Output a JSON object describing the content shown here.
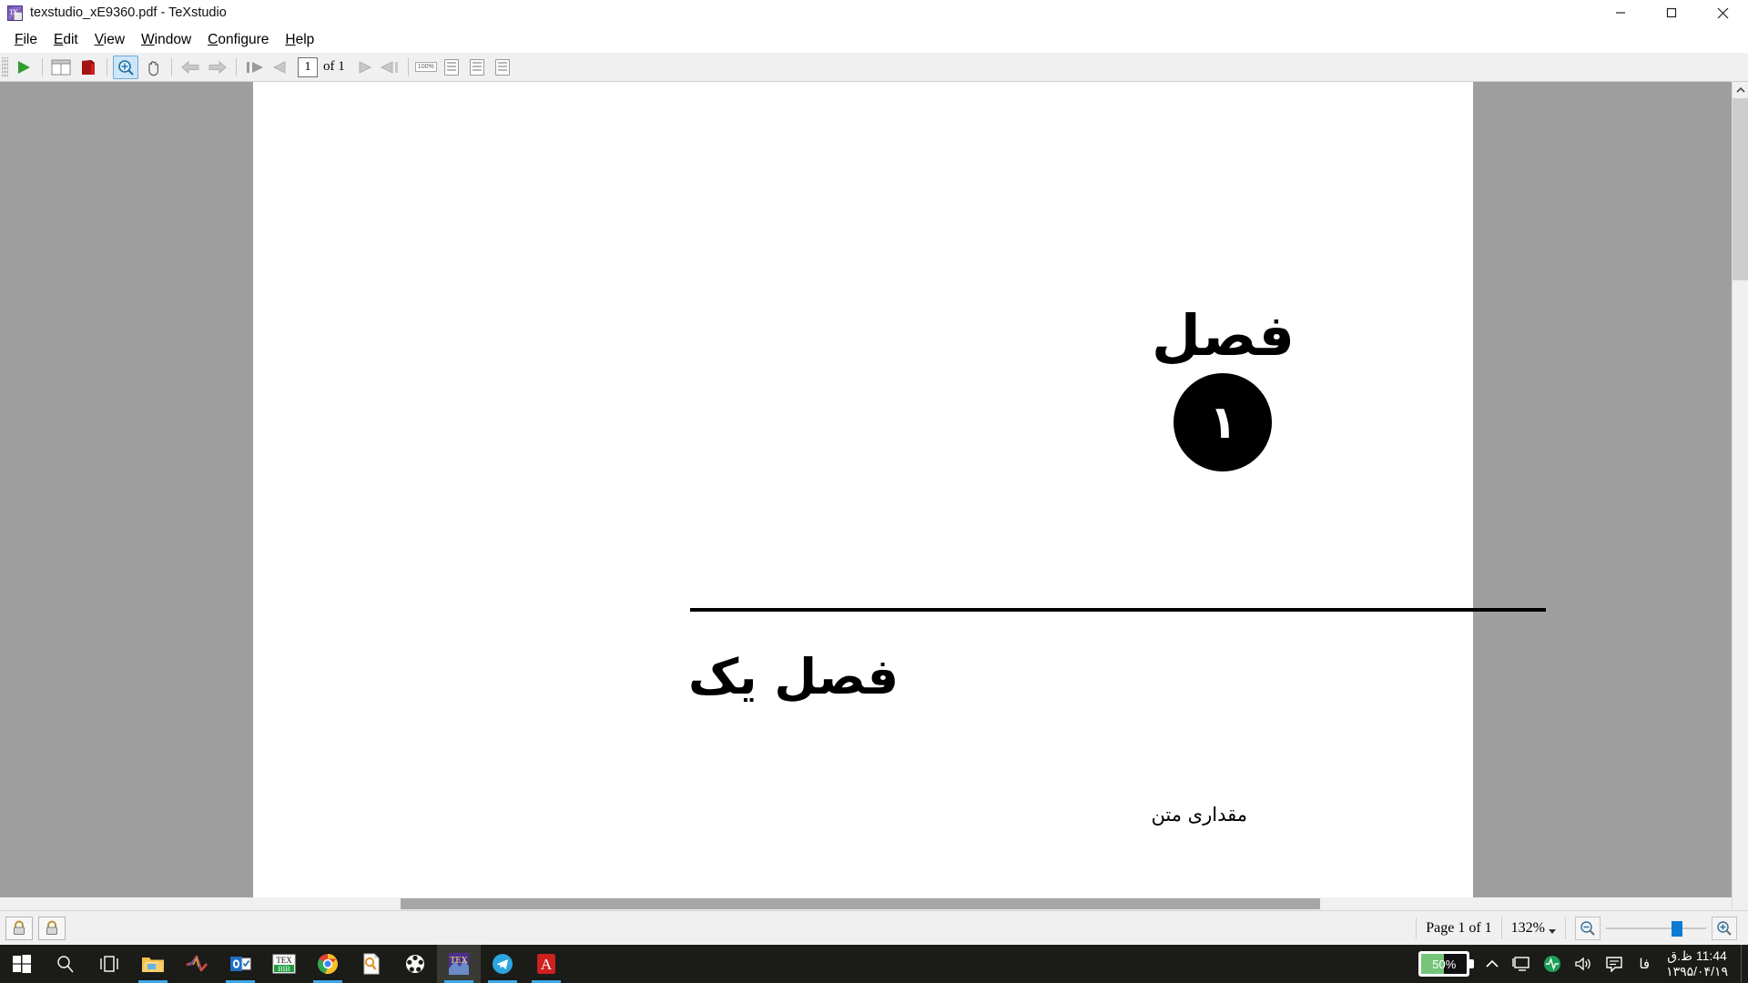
{
  "window": {
    "title": "texstudio_xE9360.pdf - TeXstudio",
    "app_icon": "texstudio-icon",
    "minimize_label": "Minimize",
    "maximize_label": "Maximize",
    "close_label": "Close"
  },
  "menubar": {
    "items": [
      {
        "label": "File",
        "mnemonic": "F",
        "rest": "ile"
      },
      {
        "label": "Edit",
        "mnemonic": "E",
        "rest": "dit"
      },
      {
        "label": "View",
        "mnemonic": "V",
        "rest": "iew"
      },
      {
        "label": "Window",
        "mnemonic": "W",
        "rest": "indow"
      },
      {
        "label": "Configure",
        "mnemonic": "C",
        "rest": "onfigure"
      },
      {
        "label": "Help",
        "mnemonic": "H",
        "rest": "elp"
      }
    ]
  },
  "toolbar": {
    "build_run_label": "Build & View",
    "view_layout_label": "Page Layout",
    "pdf_label": "Open PDF",
    "magnify_label": "Magnify",
    "hand_label": "Scroll Hand Tool",
    "back_label": "Back",
    "forward_label": "Forward",
    "first_page_label": "First Page",
    "prev_page_label": "Previous Page",
    "next_page_label": "Next Page",
    "last_page_label": "Last Page",
    "page_number_value": "1",
    "page_total_text": "of 1",
    "fit_actual_label": "100%",
    "fit_width_label": "Fit to Width",
    "fit_page_label": "Fit to Page",
    "fit_text_label": "Fit to Text Width"
  },
  "document": {
    "chapter_word": "فصل",
    "chapter_number": "۱",
    "chapter_title": "فصل یک",
    "body_text": "مقداری متن"
  },
  "statusbar": {
    "lock_left_label": "Lock Document",
    "lock_right_label": "Lock View",
    "page_text": "Page 1 of 1",
    "zoom_value": "132%",
    "zoom_out_label": "Zoom Out",
    "zoom_in_label": "Zoom In",
    "zoom_slider_label": "Zoom Slider"
  },
  "taskbar": {
    "items": [
      {
        "name": "start-button",
        "label": "Start"
      },
      {
        "name": "search-button",
        "label": "Search"
      },
      {
        "name": "task-view-button",
        "label": "Task View"
      },
      {
        "name": "file-explorer",
        "label": "File Explorer"
      },
      {
        "name": "matlab",
        "label": "MATLAB"
      },
      {
        "name": "outlook",
        "label": "Outlook"
      },
      {
        "name": "texmaker",
        "label": "TeX BibTeX"
      },
      {
        "name": "chrome",
        "label": "Google Chrome"
      },
      {
        "name": "search-doc",
        "label": "Everything Search"
      },
      {
        "name": "puzzle-app",
        "label": "Application"
      },
      {
        "name": "texstudio",
        "label": "TeXstudio"
      },
      {
        "name": "telegram",
        "label": "Telegram"
      },
      {
        "name": "acrobat",
        "label": "Adobe Acrobat"
      }
    ],
    "tray": {
      "battery_percent": "50%",
      "show_hidden_label": "Show hidden icons",
      "display_label": "Display",
      "activity_label": "Activity Monitor",
      "volume_label": "Volume",
      "notifications_label": "Notifications",
      "language": "فا",
      "time": "11:44 ظ.ق",
      "date": "۱۳۹۵/۰۴/۱۹"
    }
  },
  "colors": {
    "accent": "#0a7bd4",
    "toolbar_bg": "#f0f0f0",
    "viewer_bg": "#9e9e9e",
    "page_bg": "#ffffff",
    "taskbar_bg": "#1b1b17",
    "battery_green": "#76c47a"
  }
}
